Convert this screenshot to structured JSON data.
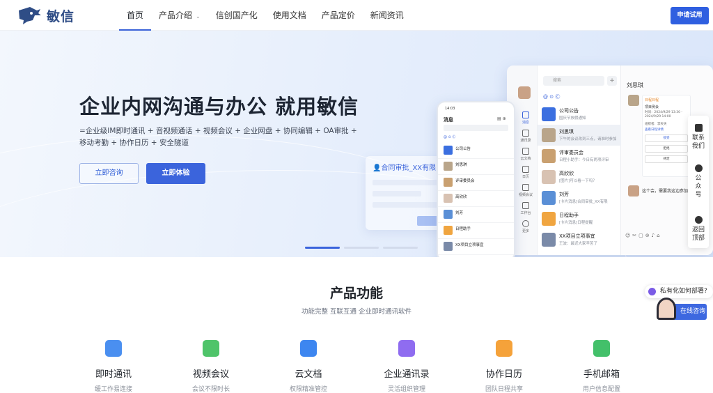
{
  "brand": {
    "name": "敏信",
    "primary": "#3b64dc",
    "logo_color": "#2f4d86"
  },
  "nav": {
    "items": [
      {
        "label": "首页",
        "active": true
      },
      {
        "label": "产品介绍",
        "dropdown": true
      },
      {
        "label": "信创国产化"
      },
      {
        "label": "使用文档"
      },
      {
        "label": "产品定价"
      },
      {
        "label": "新闻资讯"
      }
    ],
    "apply_button": "申请试用"
  },
  "hero": {
    "title": "企业内网沟通与办公 就用敏信",
    "subtitle": "=企业级IM即时通讯 + 音视频通话 + 视频会议 + 企业网盘 + 协同编辑 + OA审批 + 移动考勤 + 协作日历 + 安全隧道",
    "btn_consult": "立即咨询",
    "btn_try": "立即体验",
    "slides_active": 1,
    "slides_total": 3
  },
  "mockup": {
    "approval_label": "合同审批_XX有限",
    "desktop": {
      "search_placeholder": "搜索",
      "chat_title": "刘思琪",
      "sidebar": [
        "消息",
        "通讯录",
        "云文档",
        "日历",
        "视频会议",
        "工作台",
        "更多"
      ],
      "conversations": [
        {
          "name": "公司公告",
          "msg": "国庆节放假通知",
          "time": "",
          "color": "#3b6fe0"
        },
        {
          "name": "刘思琪",
          "msg": "下午的会议改到三点，请准时参加",
          "time": "",
          "color": "#b9a58a",
          "highlight": true
        },
        {
          "name": "评审委员会",
          "msg": "日程小助手：今日有两项评审",
          "time": "",
          "color": "#c9a070"
        },
        {
          "name": "高欣欣",
          "msg": "[图片]可以看一下吗？",
          "time": "",
          "color": "#d8c2b2"
        },
        {
          "name": "刘芳",
          "msg": "[卡片消息]合同审批_XX有限",
          "time": "",
          "color": "#5a8fd6"
        },
        {
          "name": "日程助手",
          "msg": "[卡片消息]日程提醒",
          "time": "",
          "color": "#f0a540"
        },
        {
          "name": "XX项目立项事宜",
          "msg": "王波：最近大家辛苦了",
          "time": "",
          "color": "#7a8aa8"
        }
      ],
      "chat_card": {
        "title": "日程日程",
        "event": "项目例会",
        "time": "时间：2024/9/29 13:30 - 2024/9/29 14:00",
        "organizer": "组织者：李天天",
        "link": "查看日程详情",
        "btn_accept": "接受",
        "btn_decline": "拒绝",
        "btn_pending": "待定"
      },
      "chat_msg": "这个会，需要我这边参加吗"
    },
    "phone": {
      "time": "14:03",
      "title": "消息",
      "rows": [
        {
          "name": "公司公告",
          "color": "#3b6fe0"
        },
        {
          "name": "刘思琪",
          "color": "#b9a58a"
        },
        {
          "name": "评审委员会",
          "color": "#c9a070"
        },
        {
          "name": "高欣欣",
          "color": "#d8c2b2"
        },
        {
          "name": "刘芳",
          "color": "#5a8fd6"
        },
        {
          "name": "日程助手",
          "color": "#f0a540"
        },
        {
          "name": "XX项目立项事宜",
          "color": "#7a8aa8"
        }
      ]
    }
  },
  "floatbar": {
    "contact": "联系我们",
    "wechat": "公众号",
    "top": "返回顶部"
  },
  "features": {
    "title": "产品功能",
    "subtitle": "功能完整 互联互通 企业即时通讯软件",
    "items": [
      {
        "name": "即时通讯",
        "desc": "缓工作易连接",
        "color": "#4a8ff0",
        "icon": "chat-icon"
      },
      {
        "name": "视频会议",
        "desc": "会议不限时长",
        "color": "#4fc46a",
        "icon": "video-icon"
      },
      {
        "name": "云文档",
        "desc": "权限精准管控",
        "color": "#3d86f0",
        "icon": "cloud-doc-icon"
      },
      {
        "name": "企业通讯录",
        "desc": "灵活组织管理",
        "color": "#8f6cf0",
        "icon": "contacts-icon"
      },
      {
        "name": "协作日历",
        "desc": "团队日程共享",
        "color": "#f5a23a",
        "icon": "calendar-icon"
      },
      {
        "name": "手机邮箱",
        "desc": "用户信息配置",
        "color": "#43c06a",
        "icon": "mail-icon"
      }
    ]
  },
  "chat_widget": {
    "bubble": "私有化如何部署?",
    "online": "在线咨询"
  }
}
